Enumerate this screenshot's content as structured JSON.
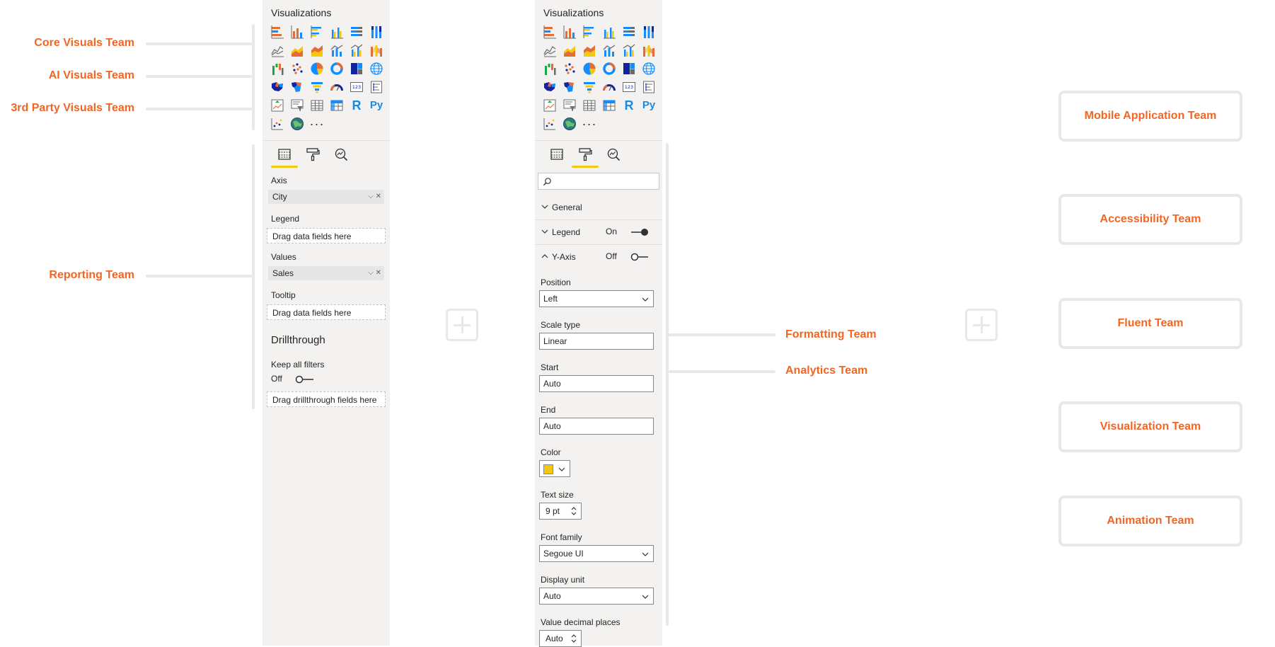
{
  "left_labels": {
    "core": "Core Visuals Team",
    "ai": "AI Visuals Team",
    "third_party": "3rd Party Visuals Team",
    "reporting": "Reporting Team"
  },
  "middle_labels": {
    "formatting": "Formatting Team",
    "analytics": "Analytics Team"
  },
  "right_boxes": [
    {
      "label": "Mobile Application Team"
    },
    {
      "label": "Accessibility Team"
    },
    {
      "label": "Fluent Team"
    },
    {
      "label": "Visualization Team"
    },
    {
      "label": "Animation Team"
    }
  ],
  "panel1": {
    "title": "Visualizations",
    "axis_label": "Axis",
    "axis_value": "City",
    "legend_label": "Legend",
    "legend_placeholder": "Drag data fields here",
    "values_label": "Values",
    "values_value": "Sales",
    "tooltip_label": "Tooltip",
    "tooltip_placeholder": "Drag data fields here",
    "drillthrough_heading": "Drillthrough",
    "keep_filters_label": "Keep all filters",
    "keep_filters_state": "Off",
    "drillthrough_placeholder": "Drag drillthrough fields here"
  },
  "panel2": {
    "title": "Visualizations",
    "general_label": "General",
    "legend_label": "Legend",
    "legend_state": "On",
    "yaxis_label": "Y-Axis",
    "yaxis_state": "Off",
    "position_label": "Position",
    "position_value": "Left",
    "scale_label": "Scale type",
    "scale_value": "Linear",
    "start_label": "Start",
    "start_value": "Auto",
    "end_label": "End",
    "end_value": "Auto",
    "color_label": "Color",
    "color_value": "#f2c811",
    "textsize_label": "Text size",
    "textsize_value": "9 pt",
    "fontfamily_label": "Font family",
    "fontfamily_value": "Segoue UI",
    "displayunit_label": "Display unit",
    "displayunit_value": "Auto",
    "decimals_label": "Value decimal places",
    "decimals_value": "Auto"
  },
  "viz_icons": [
    "stacked-bar-icon",
    "stacked-column-icon",
    "clustered-bar-icon",
    "clustered-column-icon",
    "100-percent-bar-icon",
    "100-percent-column-icon",
    "line-chart-icon",
    "area-chart-icon",
    "stacked-area-icon",
    "line-column-icon",
    "line-clustered-column-icon",
    "ribbon-chart-icon",
    "waterfall-icon",
    "scatter-icon",
    "pie-chart-icon",
    "donut-chart-icon",
    "treemap-icon",
    "globe-map-icon",
    "filled-map-icon",
    "shape-map-icon",
    "funnel-icon",
    "gauge-icon",
    "card-icon",
    "multi-row-card-icon",
    "kpi-icon",
    "slicer-icon",
    "table-icon",
    "matrix-icon",
    "r-script-icon",
    "python-icon",
    "key-influencers-icon",
    "arcgis-map-icon",
    "more-icon"
  ],
  "colors": {
    "accent": "#f26522",
    "brand_yellow": "#f2c811",
    "panel_bg": "#f3f2f1",
    "connector": "#e8e8ea"
  }
}
